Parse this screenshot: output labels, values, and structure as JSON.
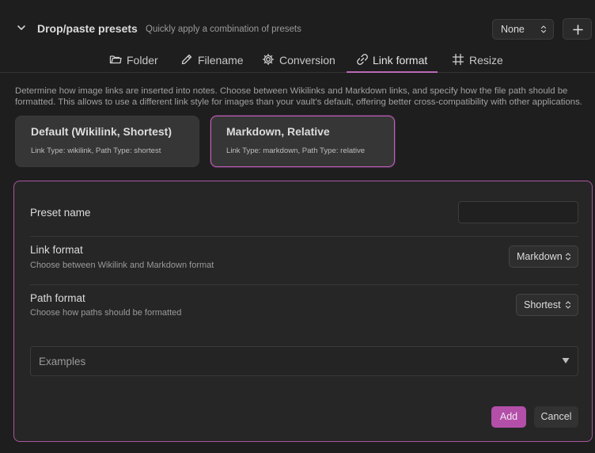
{
  "header": {
    "title": "Drop/paste presets",
    "description": "Quickly apply a combination of presets",
    "preset_select_value": "None",
    "add_label": "+"
  },
  "tabs": [
    {
      "label": "Folder",
      "icon": "folder-icon",
      "active": false
    },
    {
      "label": "Filename",
      "icon": "pencil-icon",
      "active": false
    },
    {
      "label": "Conversion",
      "icon": "gear-icon",
      "active": false
    },
    {
      "label": "Link format",
      "icon": "link-icon",
      "active": true
    },
    {
      "label": "Resize",
      "icon": "hash-icon",
      "active": false
    }
  ],
  "description": "Determine how image links are inserted into notes. Choose between Wikilinks and Markdown links, and specify how the file path should be formatted. This allows to use a different link style for images than your vault's default, offering better cross-compatibility with other applications.",
  "presets": [
    {
      "title": "Default (Wikilink, Shortest)",
      "subtitle": "Link Type: wikilink, Path Type: shortest",
      "selected": false
    },
    {
      "title": "Markdown, Relative",
      "subtitle": "Link Type: markdown, Path Type: relative",
      "selected": true
    }
  ],
  "form": {
    "preset_name_label": "Preset name",
    "preset_name_value": "",
    "link_format_label": "Link format",
    "link_format_desc": "Choose between Wikilink and Markdown format",
    "link_format_value": "Markdown",
    "path_format_label": "Path format",
    "path_format_desc": "Choose how paths should be formatted",
    "path_format_value": "Shortest",
    "examples_label": "Examples",
    "add_label": "Add",
    "cancel_label": "Cancel"
  },
  "colors": {
    "accent": "#b34fa9",
    "accent_border": "#c45fbe",
    "background": "#1e1e1e"
  }
}
